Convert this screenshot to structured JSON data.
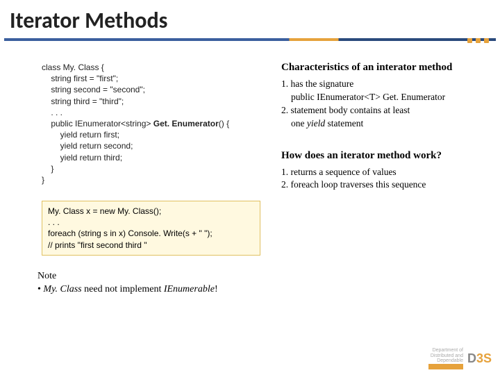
{
  "title": "Iterator Methods",
  "code1": {
    "l1": "class My. Class {",
    "l2": "    string first = \"first\";",
    "l3": "    string second = \"second\";",
    "l4": "    string third = \"third\";",
    "l5": "    . . .",
    "l6a": "    public IEnumerator<string> ",
    "l6b": "Get. Enumerator",
    "l6c": "() {",
    "l7": "        yield return first;",
    "l8": "        yield return second;",
    "l9": "        yield return third;",
    "l10": "    }",
    "l11": "}"
  },
  "code2": {
    "l1": "My. Class x = new My. Class();",
    "l2": ". . .",
    "l3": "foreach (string s in x) Console. Write(s + \" \");",
    "l4": "// prints \"first second third \""
  },
  "note": {
    "l1": "Note",
    "l2a": " • ",
    "l2b": "My. Class",
    "l2c": " need not implement ",
    "l2d": "IEnumerable",
    "l2e": "!"
  },
  "char": {
    "heading": "Characteristics of an interator method",
    "l1": "1. has the signature",
    "l2": "public IEnumerator<T> Get. Enumerator",
    "l3a": "2. statement body contains at least",
    "l3b": "one ",
    "l3c": "yield",
    "l3d": " statement"
  },
  "how": {
    "heading": "How does an iterator method work?",
    "l1": "1. returns a sequence of values",
    "l2": "2. foreach loop traverses this sequence"
  },
  "footer": {
    "dept1": "Department of",
    "dept2": "Distributed and",
    "dept3": "Dependable",
    "logo_d": "D",
    "logo_3s": "3S"
  }
}
